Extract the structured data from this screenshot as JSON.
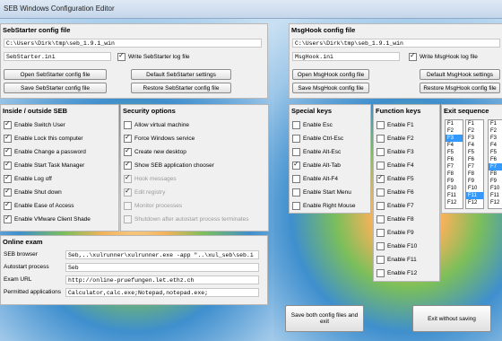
{
  "window": {
    "title": "SEB Windows Configuration Editor"
  },
  "sebstarter": {
    "header": "SebStarter config file",
    "path": "C:\\Users\\Dirk\\tmp\\seb_1.9.1_win",
    "file": "SebStarter.ini",
    "write_log": "Write SebStarter log file",
    "open_btn": "Open SebStarter config file",
    "default_btn": "Default SebStarter settings",
    "save_btn": "Save SebStarter config file",
    "restore_btn": "Restore SebStarter config file"
  },
  "inside_outside": {
    "header": "Inside / outside SEB",
    "items": [
      {
        "label": "Enable Switch User",
        "checked": true
      },
      {
        "label": "Enable Lock this computer",
        "checked": true
      },
      {
        "label": "Enable Change a password",
        "checked": true
      },
      {
        "label": "Enable Start Task Manager",
        "checked": true
      },
      {
        "label": "Enable Log off",
        "checked": true
      },
      {
        "label": "Enable Shut down",
        "checked": true
      },
      {
        "label": "Enable Ease of Access",
        "checked": true
      },
      {
        "label": "Enable VMware Client Shade",
        "checked": true
      }
    ]
  },
  "security": {
    "header": "Security options",
    "items": [
      {
        "label": "Allow virtual machine",
        "checked": false,
        "disabled": false
      },
      {
        "label": "Force Windows service",
        "checked": true,
        "disabled": false
      },
      {
        "label": "Create new desktop",
        "checked": true,
        "disabled": false
      },
      {
        "label": "Show SEB application chooser",
        "checked": true,
        "disabled": false
      },
      {
        "label": "Hook messages",
        "checked": true,
        "disabled": true
      },
      {
        "label": "Edit registry",
        "checked": true,
        "disabled": true
      },
      {
        "label": "Monitor processes",
        "checked": false,
        "disabled": true
      },
      {
        "label": "Shutdown after autostart process terminates",
        "checked": false,
        "disabled": true
      }
    ]
  },
  "online_exam": {
    "header": "Online exam",
    "rows": [
      {
        "label": "SEB browser",
        "value": "Seb,..\\xulrunner\\xulrunner.exe -app \"..\\xul_seb\\seb.i"
      },
      {
        "label": "Autostart process",
        "value": "Seb"
      },
      {
        "label": "Exam URL",
        "value": "http://online-pruefungen.let.ethz.ch"
      },
      {
        "label": "Permitted applications",
        "value": "Calculator,calc.exe;Notepad,notepad.exe;"
      }
    ]
  },
  "msghook": {
    "header": "MsgHook config file",
    "path": "C:\\Users\\Dirk\\tmp\\seb_1.9.1_win",
    "file": "MsgHook.ini",
    "write_log": "Write MsgHook log file",
    "open_btn": "Open MsgHook config file",
    "default_btn": "Default MsgHook settings",
    "save_btn": "Save MsgHook config file",
    "restore_btn": "Restore MsgHook config file"
  },
  "special_keys": {
    "header": "Special keys",
    "items": [
      {
        "label": "Enable Esc",
        "checked": false
      },
      {
        "label": "Enable Ctrl-Esc",
        "checked": false
      },
      {
        "label": "Enable Alt-Esc",
        "checked": false
      },
      {
        "label": "Enable Alt-Tab",
        "checked": true
      },
      {
        "label": "Enable Alt-F4",
        "checked": false
      },
      {
        "label": "Enable Start Menu",
        "checked": false
      },
      {
        "label": "Enable Right Mouse",
        "checked": false
      }
    ]
  },
  "function_keys": {
    "header": "Function keys",
    "items": [
      {
        "label": "Enable F1",
        "checked": false
      },
      {
        "label": "Enable F2",
        "checked": false
      },
      {
        "label": "Enable F3",
        "checked": false
      },
      {
        "label": "Enable F4",
        "checked": false
      },
      {
        "label": "Enable F5",
        "checked": true
      },
      {
        "label": "Enable F6",
        "checked": false
      },
      {
        "label": "Enable F7",
        "checked": false
      },
      {
        "label": "Enable F8",
        "checked": false
      },
      {
        "label": "Enable F9",
        "checked": false
      },
      {
        "label": "Enable F10",
        "checked": false
      },
      {
        "label": "Enable F11",
        "checked": false
      },
      {
        "label": "Enable F12",
        "checked": false
      }
    ]
  },
  "exit_sequence": {
    "header": "Exit sequence",
    "list1": {
      "items": [
        "F1",
        "F2",
        "F3",
        "F4",
        "F5",
        "F6",
        "F7",
        "F8",
        "F9",
        "F10",
        "F11",
        "F12"
      ],
      "selected": "F3"
    },
    "list2": {
      "items": [
        "F1",
        "F2",
        "F3",
        "F4",
        "F5",
        "F6",
        "F7",
        "F8",
        "F9",
        "F10",
        "F11",
        "F12"
      ],
      "selected": "F11"
    },
    "list3": {
      "items": [
        "F1",
        "F2",
        "F3",
        "F4",
        "F5",
        "F6",
        "F7",
        "F8",
        "F9",
        "F10",
        "F11",
        "F12"
      ],
      "selected": "F7"
    }
  },
  "bottom": {
    "save_exit": "Save both config files and exit",
    "exit_nosave": "Exit without saving"
  },
  "colors": {
    "selection": "#3399ff",
    "panel": "#f0f0f0"
  }
}
